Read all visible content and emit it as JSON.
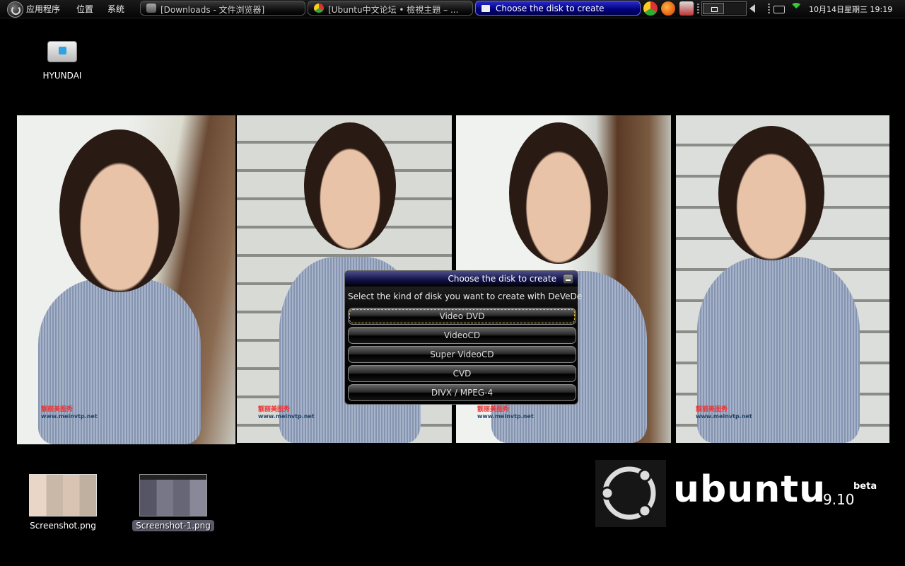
{
  "panel": {
    "menus": [
      "应用程序",
      "位置",
      "系统"
    ],
    "tasks": [
      {
        "label": "[Downloads - 文件浏览器]"
      },
      {
        "label": "[Ubuntu中文论坛 • 檢視主題 – ..."
      },
      {
        "label": "Choose the disk to create"
      }
    ],
    "clock": "10月14日星期三  19:19"
  },
  "desktop": {
    "drive_label": "HYUNDAI",
    "files": [
      {
        "label": "Screenshot.png"
      },
      {
        "label": "Screenshot-1.png"
      }
    ]
  },
  "wallpaper": {
    "watermark_text": "靓丽美图秀",
    "watermark_url": "www.meinvtp.net"
  },
  "dialog": {
    "title": "Choose the disk to create",
    "prompt": "Select the kind of disk you want to create with DeVeDe",
    "options": [
      "Video DVD",
      "VideoCD",
      "Super VideoCD",
      "CVD",
      "DIVX / MPEG-4"
    ],
    "focused": "Video DVD"
  },
  "branding": {
    "word": "ubuntu",
    "version": "9.10",
    "tag": "beta"
  },
  "colors": {
    "active_task": "#00007a",
    "dialog_title": "#101044",
    "focus_outline": "#e8c24a"
  }
}
